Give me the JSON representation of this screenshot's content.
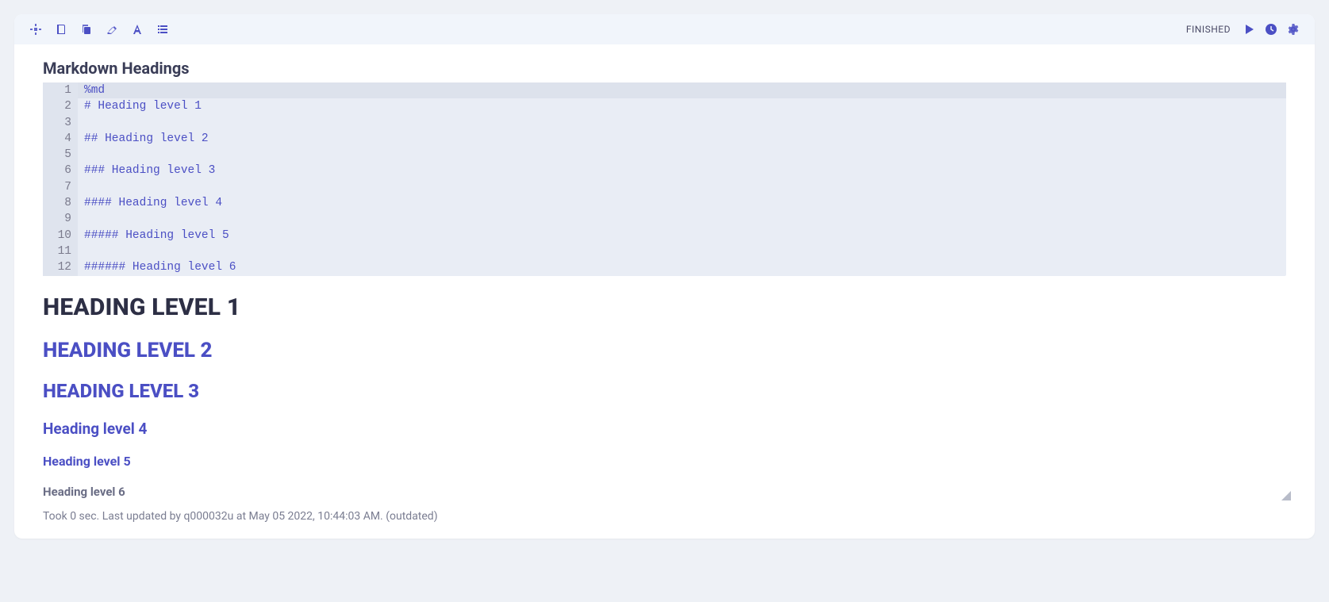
{
  "toolbar": {
    "status": "FINISHED"
  },
  "cell": {
    "title": "Markdown Headings",
    "code_lines": [
      "%md",
      "# Heading level 1",
      "",
      "## Heading level 2",
      "",
      "### Heading level 3",
      "",
      "#### Heading level 4",
      "",
      "##### Heading level 5",
      "",
      "###### Heading level 6"
    ]
  },
  "output": {
    "h1": "HEADING LEVEL 1",
    "h2": "HEADING LEVEL 2",
    "h3": "HEADING LEVEL 3",
    "h4": "Heading level 4",
    "h5": "Heading level 5",
    "h6": "Heading level 6"
  },
  "footer": {
    "text": "Took 0 sec. Last updated by q000032u at May 05 2022, 10:44:03 AM. (outdated)"
  }
}
